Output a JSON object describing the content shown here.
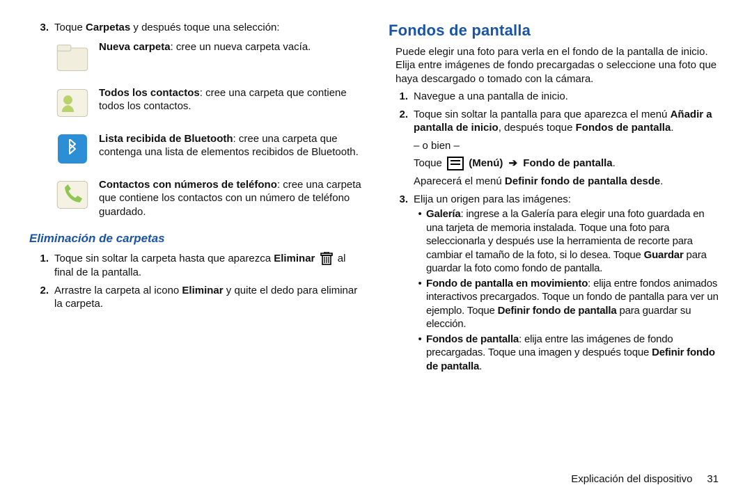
{
  "left": {
    "step3_num": "3.",
    "step3_text_a": "Toque ",
    "step3_text_b": "Carpetas",
    "step3_text_c": " y después toque una selección:",
    "opt1_b": "Nueva carpeta",
    "opt1_t": ": cree un nueva carpeta vacía.",
    "opt2_b": "Todos los contactos",
    "opt2_t": ": cree una carpeta que contiene todos los contactos.",
    "opt3_b": "Lista recibida de Bluetooth",
    "opt3_t": ": cree una carpeta que contenga una lista de elementos recibidos de Bluetooth.",
    "opt4_b": "Contactos con números de teléfono",
    "opt4_t": ": cree una carpeta que contiene los contactos con un número de teléfono guardado.",
    "h_del": "Eliminación de carpetas",
    "del1_num": "1.",
    "del1_a": "Toque sin soltar la carpeta hasta que aparezca ",
    "del1_b": "Eliminar",
    "del1_c": " al final de la pantalla.",
    "del2_num": "2.",
    "del2_a": "Arrastre la carpeta al icono ",
    "del2_b": "Eliminar",
    "del2_c": " y quite el dedo para eliminar la carpeta."
  },
  "right": {
    "h_wall": "Fondos de pantalla",
    "intro": "Puede elegir una foto para verla en el fondo de la pantalla de inicio. Elija entre imágenes de fondo precargadas o seleccione una foto que haya descargado o tomado con la cámara.",
    "s1_num": "1.",
    "s1": "Navegue a una pantalla de inicio.",
    "s2_num": "2.",
    "s2_a": "Toque sin soltar la pantalla para que aparezca el menú ",
    "s2_b": "Añadir a pantalla de inicio",
    "s2_c": ", después toque ",
    "s2_d": "Fondos de pantalla",
    "s2_e": ".",
    "or": "– o bien –",
    "alt_a": "Toque ",
    "alt_b": " (Menú) ",
    "alt_arrow": "➔",
    "alt_c": " Fondo de pantalla",
    "alt_d": ".",
    "appear_a": "Aparecerá el menú ",
    "appear_b": "Definir fondo de pantalla desde",
    "appear_c": ".",
    "s3_num": "3.",
    "s3": "Elija un origen para las imágenes:",
    "b1_b": "Galería",
    "b1_t": ": ingrese a la Galería para elegir una foto guardada en una tarjeta de memoria instalada. Toque una foto para seleccionarla y después use la herramienta de recorte para cambiar el tamaño de la foto, si lo desea. Toque ",
    "b1_g": "Guardar",
    "b1_t2": " para guardar la foto como fondo de pantalla.",
    "b2_b": "Fondo de pantalla en movimiento",
    "b2_t": ": elija entre fondos animados interactivos precargados. Toque un fondo de pantalla para ver un ejemplo. Toque ",
    "b2_g": "Definir fondo de pantalla",
    "b2_t2": " para guardar su elección.",
    "b3_b": "Fondos de pantalla",
    "b3_t": ": elija entre las imágenes de fondo precargadas. Toque una imagen y después toque ",
    "b3_g": "Definir fondo de pantalla",
    "b3_t2": "."
  },
  "footer": {
    "section": "Explicación del dispositivo",
    "page": "31"
  }
}
